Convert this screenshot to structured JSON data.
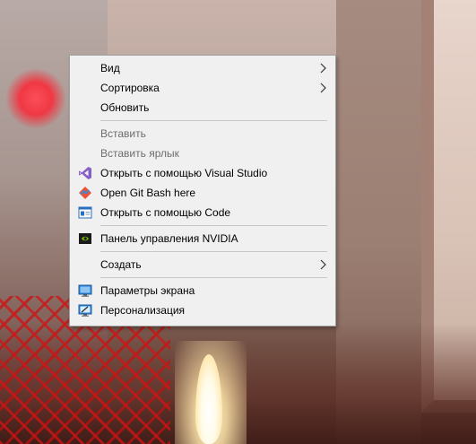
{
  "context_menu": {
    "items": [
      {
        "label": "Вид",
        "icon": "",
        "submenu": true,
        "enabled": true
      },
      {
        "label": "Сортировка",
        "icon": "",
        "submenu": true,
        "enabled": true
      },
      {
        "label": "Обновить",
        "icon": "",
        "submenu": false,
        "enabled": true
      },
      {
        "label": "Вставить",
        "icon": "",
        "submenu": false,
        "enabled": false
      },
      {
        "label": "Вставить ярлык",
        "icon": "",
        "submenu": false,
        "enabled": false
      },
      {
        "label": "Открыть с помощью Visual Studio",
        "icon": "visual-studio-icon",
        "submenu": false,
        "enabled": true
      },
      {
        "label": "Open Git Bash here",
        "icon": "git-bash-icon",
        "submenu": false,
        "enabled": true
      },
      {
        "label": "Открыть с помощью Code",
        "icon": "vscode-icon",
        "submenu": false,
        "enabled": true
      },
      {
        "label": "Панель управления NVIDIA",
        "icon": "nvidia-icon",
        "submenu": false,
        "enabled": true
      },
      {
        "label": "Создать",
        "icon": "",
        "submenu": true,
        "enabled": true
      },
      {
        "label": "Параметры экрана",
        "icon": "display-settings-icon",
        "submenu": false,
        "enabled": true
      },
      {
        "label": "Персонализация",
        "icon": "personalization-icon",
        "submenu": false,
        "enabled": true
      }
    ]
  },
  "colors": {
    "menu_background": "#f0f0f0",
    "menu_border": "#a0a0a0",
    "separator": "#c7c7c7",
    "disabled_text": "#6d6d6d",
    "visual_studio_purple": "#865fc5",
    "git_orange": "#f05133",
    "nvidia_green": "#76b900"
  }
}
